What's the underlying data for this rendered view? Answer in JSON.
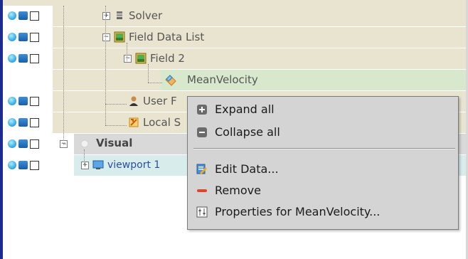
{
  "tree": {
    "solver_label": "Solver",
    "field_data_list_label": "Field Data List",
    "field2_label": "Field 2",
    "mean_velocity_label": "MeanVelocity",
    "user_label_partial": "User F",
    "local_label_partial": "Local S",
    "visual_label": "Visual",
    "viewport_label": "viewport 1"
  },
  "context_menu": {
    "items": [
      {
        "label": "Expand all",
        "icon": "expand-all-icon"
      },
      {
        "label": "Collapse all",
        "icon": "collapse-all-icon"
      },
      {
        "label": "Edit Data...",
        "icon": "edit-data-icon"
      },
      {
        "label": "Remove",
        "icon": "remove-icon"
      },
      {
        "label": "Properties for MeanVelocity...",
        "icon": "properties-icon"
      }
    ]
  },
  "colors": {
    "tree_background": "#e9e4cf",
    "selected_row": "#d7e8cc",
    "visual_row": "#d9d9d9",
    "viewport_row": "#d9ecec",
    "menu_background": "#d4d4d4",
    "left_border": "#1b2b8f"
  }
}
